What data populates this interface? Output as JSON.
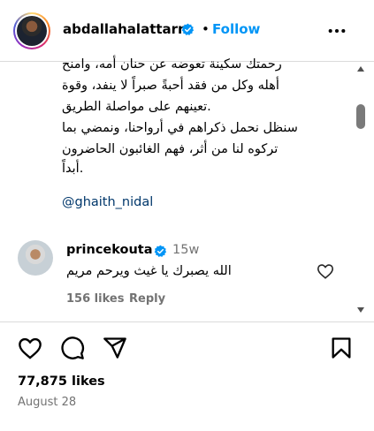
{
  "post_header": {
    "username": "abdallahalattarr",
    "separator": "•",
    "follow_label": "Follow"
  },
  "caption": {
    "lines": [
      "رحمتك سكينة تعوضه عن حنان أمه، وامنح",
      "أهله وكل من فقد أحبةً صبراً لا ينفد، وقوة",
      ".تعينهم على مواصلة الطريق",
      "سنظل نحمل ذكراهم في أرواحنا، ونمضي بما",
      "تركوه لنا من أثر، فهم الغائبون الحاضرون",
      ".أبداً"
    ],
    "mention": "@ghaith_nidal"
  },
  "comment": {
    "username": "princekouta",
    "time": "15w",
    "text": "الله يصبرك يا غيث ويرحم مريم",
    "likes": "156 likes",
    "reply_label": "Reply"
  },
  "post_footer": {
    "likes": "77,875 likes",
    "date": "August 28"
  },
  "icons": {
    "verified": "verified-badge-icon",
    "more": "more-horizontal-icon",
    "heart": "heart-icon",
    "comment": "comment-icon",
    "share": "share-icon",
    "save": "bookmark-icon"
  },
  "colors": {
    "accent": "#0095f6",
    "mention": "#00376b",
    "secondary_text": "#737373",
    "verified": "#0095f6"
  }
}
